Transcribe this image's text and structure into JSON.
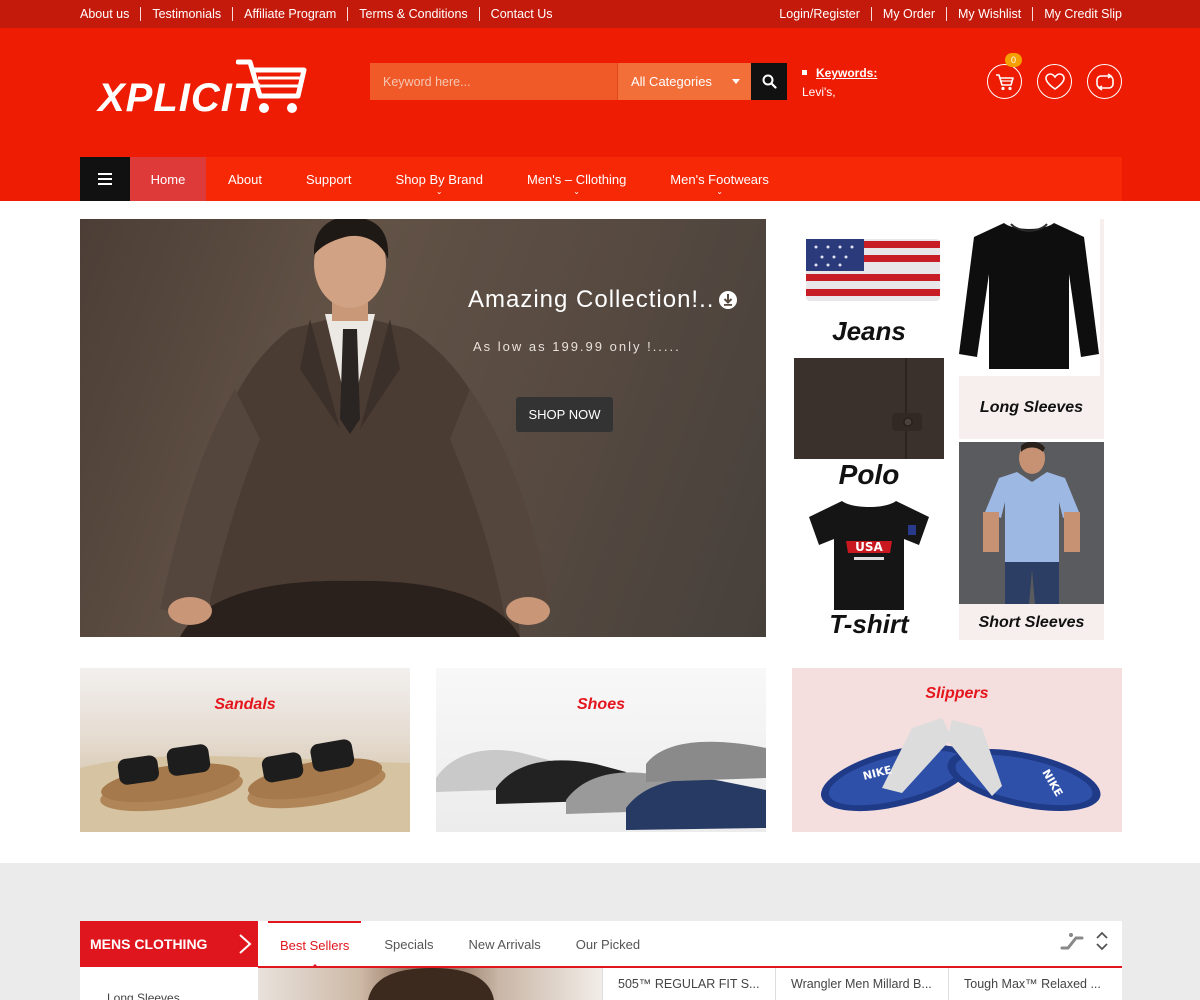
{
  "topbar": {
    "left_links": [
      "About us",
      "Testimonials",
      "Affiliate Program",
      "Terms & Conditions",
      "Contact Us"
    ],
    "right_links": [
      "Login/Register",
      "My Order",
      "My Wishlist",
      "My Credit Slip"
    ]
  },
  "header": {
    "logo_text": "XPLICIT",
    "search_placeholder": "Keyword here...",
    "category_selected": "All Categories",
    "keywords_title": "Keywords:",
    "keywords_value": "Levi's,",
    "cart_count": "0",
    "icons": [
      "cart-icon",
      "heart-icon",
      "compare-icon"
    ]
  },
  "nav": {
    "items": [
      {
        "label": "Home",
        "active": true
      },
      {
        "label": "About"
      },
      {
        "label": "Support"
      },
      {
        "label": "Shop By Brand",
        "submenu": true
      },
      {
        "label": "Men's – Cllothing",
        "submenu": true
      },
      {
        "label": "Men's Footwears",
        "submenu": true
      }
    ]
  },
  "hero": {
    "title": "Amazing Collection!..",
    "subtitle": "As low as 199.99 only !.....",
    "button": "SHOP NOW"
  },
  "categories": {
    "jeans": "Jeans",
    "long_sleeves": "Long Sleeves",
    "polo": "Polo",
    "tshirt": "T-shirt",
    "short_sleeves": "Short Sleeves"
  },
  "footwear": {
    "sandals": "Sandals",
    "shoes": "Shoes",
    "slippers": "Slippers"
  },
  "products": {
    "section_title": "MENS CLOTHING",
    "tabs": [
      "Best Sellers",
      "Specials",
      "New Arrivals",
      "Our Picked"
    ],
    "side_item": "Long Sleeves",
    "names": [
      "505™ REGULAR FIT S...",
      "Wrangler Men Millard B...",
      "Tough Max™ Relaxed ..."
    ]
  },
  "colors": {
    "topbar": "#c41a0b",
    "header": "#ee1c03",
    "nav": "#f72806",
    "accent": "#e0161e"
  }
}
